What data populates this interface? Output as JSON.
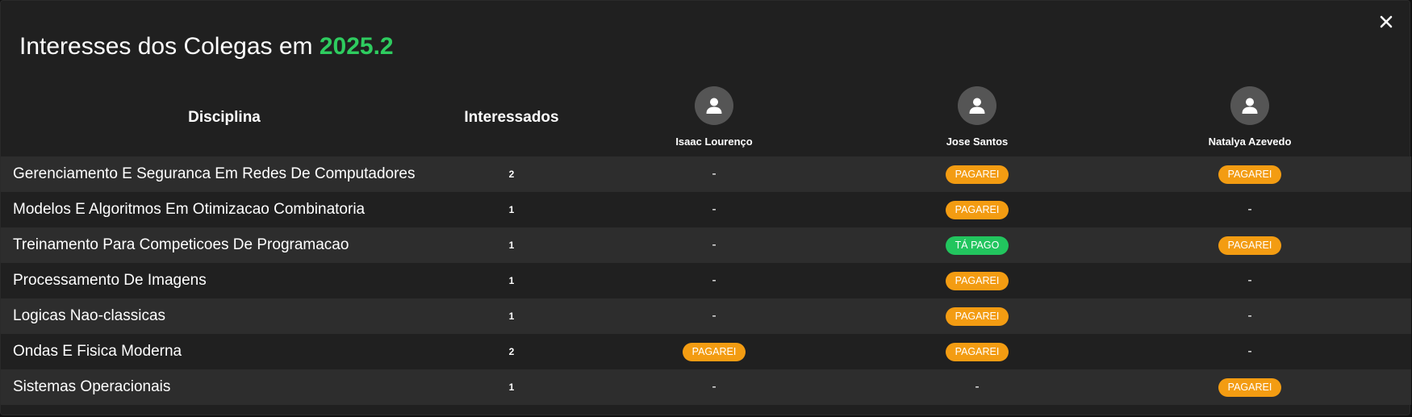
{
  "modal": {
    "title_prefix": "Interesses dos Colegas em",
    "term": "2025.2",
    "close_glyph": "✕"
  },
  "table": {
    "headers": {
      "disciplina": "Disciplina",
      "interessados": "Interessados"
    },
    "users": [
      {
        "name": "Isaac Lourenço",
        "icon": "user-icon"
      },
      {
        "name": "Jose Santos",
        "icon": "user-icon"
      },
      {
        "name": "Natalya Azevedo",
        "icon": "user-icon"
      }
    ],
    "rows": [
      {
        "disciplina": "Gerenciamento E Seguranca Em Redes De Computadores",
        "interessados": "2",
        "status": [
          "-",
          "PAGAREI",
          "PAGAREI"
        ]
      },
      {
        "disciplina": "Modelos E Algoritmos Em Otimizacao Combinatoria",
        "interessados": "1",
        "status": [
          "-",
          "PAGAREI",
          "-"
        ]
      },
      {
        "disciplina": "Treinamento Para Competicoes De Programacao",
        "interessados": "1",
        "status": [
          "-",
          "TÁ PAGO",
          "PAGAREI"
        ]
      },
      {
        "disciplina": "Processamento De Imagens",
        "interessados": "1",
        "status": [
          "-",
          "PAGAREI",
          "-"
        ]
      },
      {
        "disciplina": "Logicas Nao-classicas",
        "interessados": "1",
        "status": [
          "-",
          "PAGAREI",
          "-"
        ]
      },
      {
        "disciplina": "Ondas E Fisica Moderna",
        "interessados": "2",
        "status": [
          "PAGAREI",
          "PAGAREI",
          "-"
        ]
      },
      {
        "disciplina": "Sistemas Operacionais",
        "interessados": "1",
        "status": [
          "-",
          "-",
          "PAGAREI"
        ]
      }
    ]
  },
  "colors": {
    "term": "#2ecc5f",
    "pagarei": "#f39c12",
    "ta_pago": "#22c55e",
    "row_alt": "#2d2d2d",
    "background": "#202020"
  }
}
